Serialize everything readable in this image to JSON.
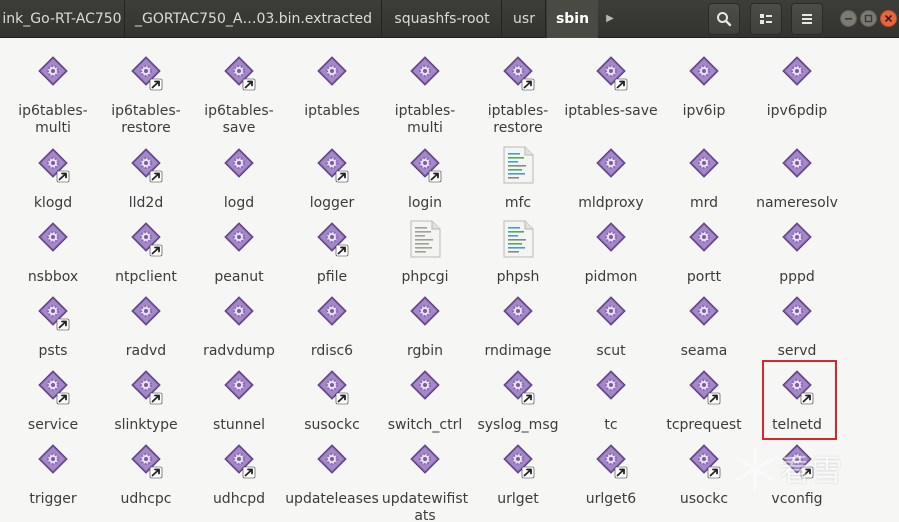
{
  "breadcrumbs": [
    {
      "label": "ink_Go-RT-AC750"
    },
    {
      "label": "_GORTAC750_A…03.bin.extracted"
    },
    {
      "label": "squashfs-root"
    },
    {
      "label": "usr"
    },
    {
      "label": "sbin"
    }
  ],
  "active_crumb": "sbin",
  "toolbar": {
    "search_icon": "search-icon",
    "view_icon": "view-options-icon",
    "menu_icon": "hamburger-menu-icon"
  },
  "window_controls": [
    "minimize-icon",
    "maximize-icon",
    "close-icon"
  ],
  "colors": {
    "executable": "#7a5aa3",
    "executable_light": "#b39ad6",
    "selection": "#d9252d",
    "script_page": "#f4f4f2"
  },
  "files": [
    {
      "name": "ip6tables-multi",
      "kind": "exec",
      "link": false
    },
    {
      "name": "ip6tables-restore",
      "kind": "exec",
      "link": true
    },
    {
      "name": "ip6tables-save",
      "kind": "exec",
      "link": true
    },
    {
      "name": "iptables",
      "kind": "exec",
      "link": false
    },
    {
      "name": "iptables-multi",
      "kind": "exec",
      "link": false
    },
    {
      "name": "iptables-restore",
      "kind": "exec",
      "link": true
    },
    {
      "name": "iptables-save",
      "kind": "exec",
      "link": true
    },
    {
      "name": "ipv6ip",
      "kind": "exec",
      "link": false
    },
    {
      "name": "ipv6pdip",
      "kind": "exec",
      "link": false
    },
    {
      "name": "klogd",
      "kind": "exec",
      "link": true
    },
    {
      "name": "lld2d",
      "kind": "exec",
      "link": true
    },
    {
      "name": "logd",
      "kind": "exec",
      "link": false
    },
    {
      "name": "logger",
      "kind": "exec",
      "link": true
    },
    {
      "name": "login",
      "kind": "exec",
      "link": true
    },
    {
      "name": "mfc",
      "kind": "script",
      "link": false
    },
    {
      "name": "mldproxy",
      "kind": "exec",
      "link": false
    },
    {
      "name": "mrd",
      "kind": "exec",
      "link": false
    },
    {
      "name": "nameresolv",
      "kind": "exec",
      "link": false
    },
    {
      "name": "nsbbox",
      "kind": "exec",
      "link": false
    },
    {
      "name": "ntpclient",
      "kind": "exec",
      "link": true
    },
    {
      "name": "peanut",
      "kind": "exec",
      "link": false
    },
    {
      "name": "pfile",
      "kind": "exec",
      "link": true
    },
    {
      "name": "phpcgi",
      "kind": "doc",
      "link": false
    },
    {
      "name": "phpsh",
      "kind": "script",
      "link": false
    },
    {
      "name": "pidmon",
      "kind": "exec",
      "link": false
    },
    {
      "name": "portt",
      "kind": "exec",
      "link": false
    },
    {
      "name": "pppd",
      "kind": "exec",
      "link": false
    },
    {
      "name": "psts",
      "kind": "exec",
      "link": true
    },
    {
      "name": "radvd",
      "kind": "exec",
      "link": false
    },
    {
      "name": "radvdump",
      "kind": "exec",
      "link": false
    },
    {
      "name": "rdisc6",
      "kind": "exec",
      "link": false
    },
    {
      "name": "rgbin",
      "kind": "exec",
      "link": false
    },
    {
      "name": "rndimage",
      "kind": "exec",
      "link": false
    },
    {
      "name": "scut",
      "kind": "exec",
      "link": false
    },
    {
      "name": "seama",
      "kind": "exec",
      "link": false
    },
    {
      "name": "servd",
      "kind": "exec",
      "link": false
    },
    {
      "name": "service",
      "kind": "exec",
      "link": true
    },
    {
      "name": "slinktype",
      "kind": "exec",
      "link": true
    },
    {
      "name": "stunnel",
      "kind": "exec",
      "link": false
    },
    {
      "name": "susockc",
      "kind": "exec",
      "link": true
    },
    {
      "name": "switch_ctrl",
      "kind": "exec",
      "link": false
    },
    {
      "name": "syslog_msg",
      "kind": "exec",
      "link": true
    },
    {
      "name": "tc",
      "kind": "exec",
      "link": false
    },
    {
      "name": "tcprequest",
      "kind": "exec",
      "link": true
    },
    {
      "name": "telnetd",
      "kind": "exec",
      "link": true
    },
    {
      "name": "trigger",
      "kind": "exec",
      "link": false
    },
    {
      "name": "udhcpc",
      "kind": "exec",
      "link": true
    },
    {
      "name": "udhcpd",
      "kind": "exec",
      "link": true
    },
    {
      "name": "updateleases",
      "kind": "exec",
      "link": false
    },
    {
      "name": "updatewifistats",
      "kind": "exec",
      "link": false
    },
    {
      "name": "urlget",
      "kind": "exec",
      "link": true
    },
    {
      "name": "urlget6",
      "kind": "exec",
      "link": true
    },
    {
      "name": "usockc",
      "kind": "exec",
      "link": true
    },
    {
      "name": "vconfig",
      "kind": "exec",
      "link": true
    }
  ],
  "selected_file": "telnetd",
  "watermark": {
    "text": "看雪"
  }
}
